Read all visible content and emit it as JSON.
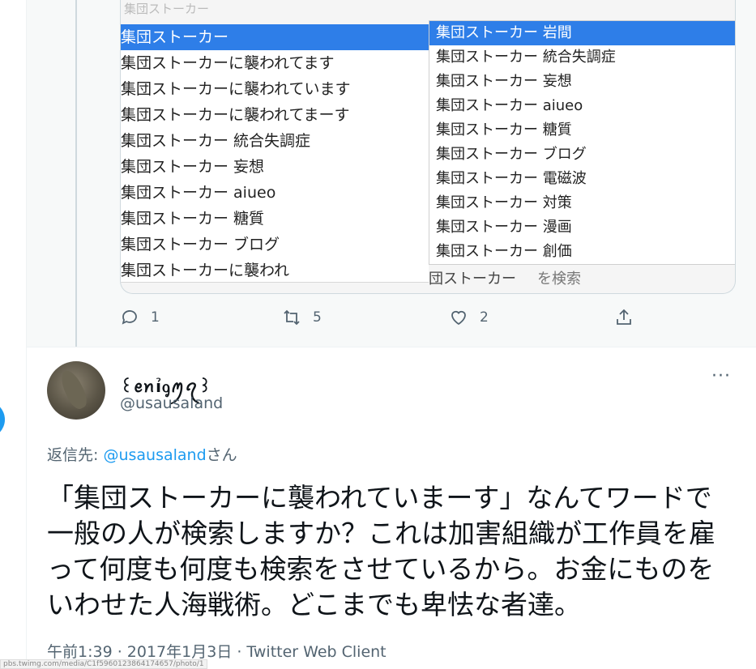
{
  "embed": {
    "faded_top": "集団ストーカー",
    "left_list": [
      "集団ストーカー",
      "集団ストーカーに襲われてます",
      "集団ストーカーに襲われています",
      "集団ストーカーに襲われてまーす",
      "集団ストーカー 統合失調症",
      "集団ストーカー 妄想",
      "集団ストーカー aiueo",
      "集団ストーカー 糖質",
      "集団ストーカー ブログ",
      "集団ストーカーに襲われ"
    ],
    "right_list": [
      "集団ストーカー 岩間",
      "集団ストーカー 統合失調症",
      "集団ストーカー 妄想",
      "集団ストーカー aiueo",
      "集団ストーカー 糖質",
      "集団ストーカー ブログ",
      "集団ストーカー 電磁波",
      "集団ストーカー 対策",
      "集団ストーカー 漫画",
      "集団ストーカー 創価"
    ],
    "search_text": "団ストーカー",
    "search_hint": "を検索"
  },
  "prev_actions": {
    "reply_count": "1",
    "retweet_count": "5",
    "like_count": "2"
  },
  "tweet": {
    "display_name": "꒰ꫀꪀỉᧁꪑꪖ꒱",
    "handle": "@usausaland",
    "more": "···",
    "reply_prefix": "返信先: ",
    "reply_mention": "@usausaland",
    "reply_suffix": "さん",
    "text": "「集団ストーカーに襲われていまーす」なんてワードで一般の人が検索しますか？これは加害組織が工作員を雇って何度も何度も検索をさせているから。お金にものをいわせた人海戦術。どこまでも卑怯な者達。",
    "meta": "午前1:39 · 2017年1月3日 · Twitter Web Client"
  },
  "status_bar_url": "pbs.twimg.com/media/C1f5960123864174657/photo/1",
  "colors": {
    "accent": "#1d9bf0",
    "selection": "#2e7ee8",
    "muted": "#536471"
  }
}
